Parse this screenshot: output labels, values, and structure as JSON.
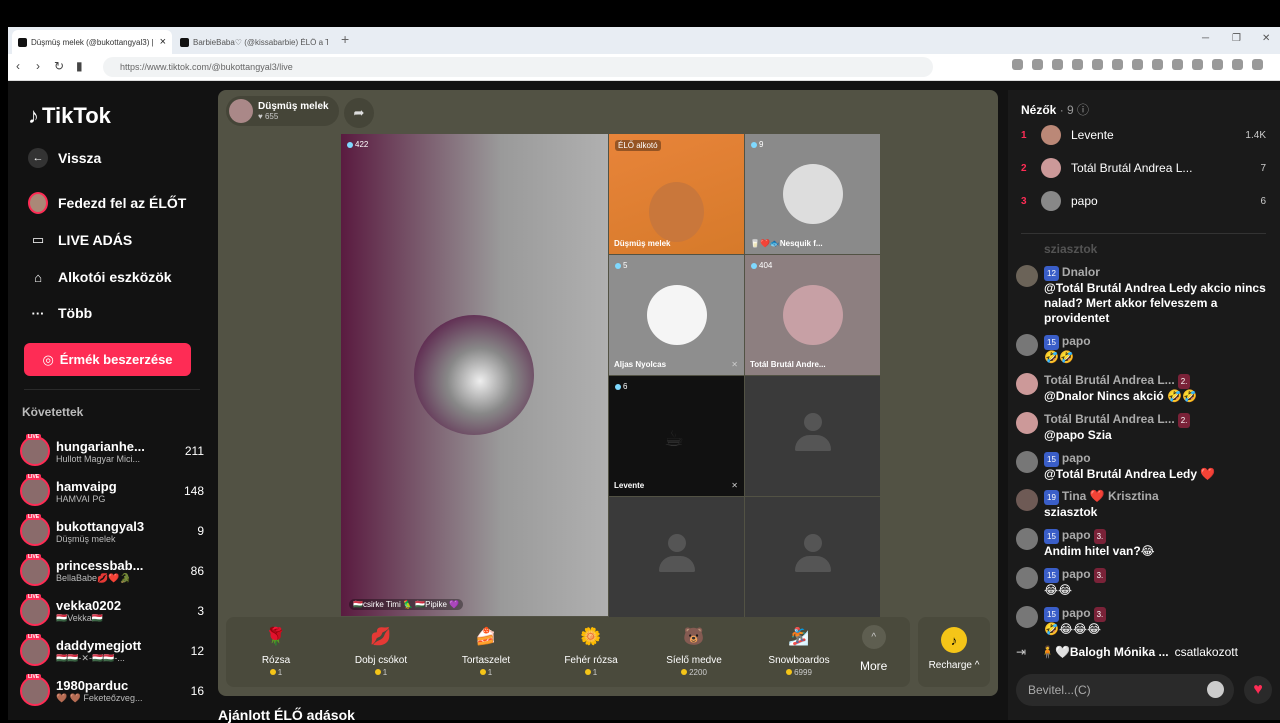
{
  "browser": {
    "tabs": [
      {
        "title": "Düşmüş melek (@bukottangyal3) | TikTok"
      },
      {
        "title": "BarbieBaba♡ (@kissabarbie) ÉLŐ a TikTok-on"
      }
    ],
    "url": "https://www.tiktok.com/@bukottangyal3/live"
  },
  "sidebar": {
    "logo": "TikTok",
    "back": "Vissza",
    "nav": [
      "Fedezd fel az ÉLŐT",
      "LIVE ADÁS",
      "Alkotói eszközök",
      "Több"
    ],
    "coins_button": "Érmék beszerzése",
    "following_title": "Követettek",
    "following": [
      {
        "name": "hungarianhe...",
        "sub": "Hullott Magyar Mici...",
        "count": "211"
      },
      {
        "name": "hamvaipg",
        "sub": "HAMVAI PG",
        "count": "148"
      },
      {
        "name": "bukottangyal3",
        "sub": "Düşmüş melek",
        "count": "9"
      },
      {
        "name": "princessbab...",
        "sub": "BellaBabe💋❤️🐊",
        "count": "86"
      },
      {
        "name": "vekka0202",
        "sub": "🇭🇺Vekka🇭🇺",
        "count": "3"
      },
      {
        "name": "daddymegjott",
        "sub": "🇭🇺🇭🇺-✕-🇭🇺🇭🇺-...",
        "count": "12"
      },
      {
        "name": "1980parduc",
        "sub": "🤎 🤎 Feketeőzveg...",
        "count": "16"
      }
    ],
    "live_badge": "LIVE"
  },
  "stage": {
    "host_name": "Düşmüş melek",
    "host_likes": "655",
    "main": {
      "viewers": "422",
      "label": "🇭🇺csirke Timi 🦜 🇭🇺Pipike 💜"
    },
    "cells": [
      {
        "badge": "ÉLŐ alkotó",
        "label": "Düşmüş melek"
      },
      {
        "badge": "9",
        "label": "🥛❤️🐟Nesquik f..."
      },
      {
        "badge": "5",
        "label": "Aljas Nyolcas"
      },
      {
        "badge": "404",
        "label": "Totál Brutál Andre..."
      },
      {
        "badge": "6",
        "label": "Levente"
      }
    ]
  },
  "gifts": [
    {
      "name": "Rózsa",
      "price": "1",
      "icon": "🌹"
    },
    {
      "name": "Dobj csókot",
      "price": "1",
      "icon": "💋"
    },
    {
      "name": "Tortaszelet",
      "price": "1",
      "icon": "🍰"
    },
    {
      "name": "Fehér rózsa",
      "price": "1",
      "icon": "🌼"
    },
    {
      "name": "Síelő medve",
      "price": "2200",
      "icon": "🐻"
    },
    {
      "name": "Snowboardos",
      "price": "6999",
      "icon": "🏂"
    }
  ],
  "more_label": "More",
  "recharge_label": "Recharge ^",
  "recommended_title": "Ajánlott ÉLŐ adások",
  "viewers": {
    "title": "Nézők",
    "count": "· 9",
    "list": [
      {
        "rank": "1",
        "name": "Levente",
        "score": "1.4K"
      },
      {
        "rank": "2",
        "name": "Totál Brutál Andrea L...",
        "score": "7"
      },
      {
        "rank": "3",
        "name": "papo",
        "score": "6"
      }
    ]
  },
  "chat": [
    {
      "user": "sziasztok",
      "level": "",
      "fan": "",
      "msg": ""
    },
    {
      "user": "Dnalor",
      "level": "12",
      "fan": "",
      "msg": "@Totál Brutál Andrea Ledy akcio nincs nalad? Mert akkor felveszem a providentet"
    },
    {
      "user": "papo",
      "level": "15",
      "fan": "",
      "msg": "🤣🤣"
    },
    {
      "user": "Totál Brutál Andrea L...",
      "level": "",
      "fan": "2.",
      "msg": "@Dnalor Nincs akció 🤣🤣"
    },
    {
      "user": "Totál Brutál Andrea L...",
      "level": "",
      "fan": "2.",
      "msg": "@papo Szia"
    },
    {
      "user": "papo",
      "level": "15",
      "fan": "",
      "msg": "@Totál Brutál Andrea Ledy ❤️"
    },
    {
      "user": "Tina ❤️ Krisztina",
      "level": "19",
      "fan": "",
      "msg": "sziasztok"
    },
    {
      "user": "papo",
      "level": "15",
      "fan": "3.",
      "msg": "Andim hitel van?😂"
    },
    {
      "user": "papo",
      "level": "15",
      "fan": "3.",
      "msg": "😂😂"
    },
    {
      "user": "papo",
      "level": "15",
      "fan": "3.",
      "msg": "🤣😂😂😂"
    }
  ],
  "joined": {
    "user": "🧍🤍Balogh Mónika ...",
    "action": "csatlakozott"
  },
  "input_placeholder": "Bevitel...(C)"
}
